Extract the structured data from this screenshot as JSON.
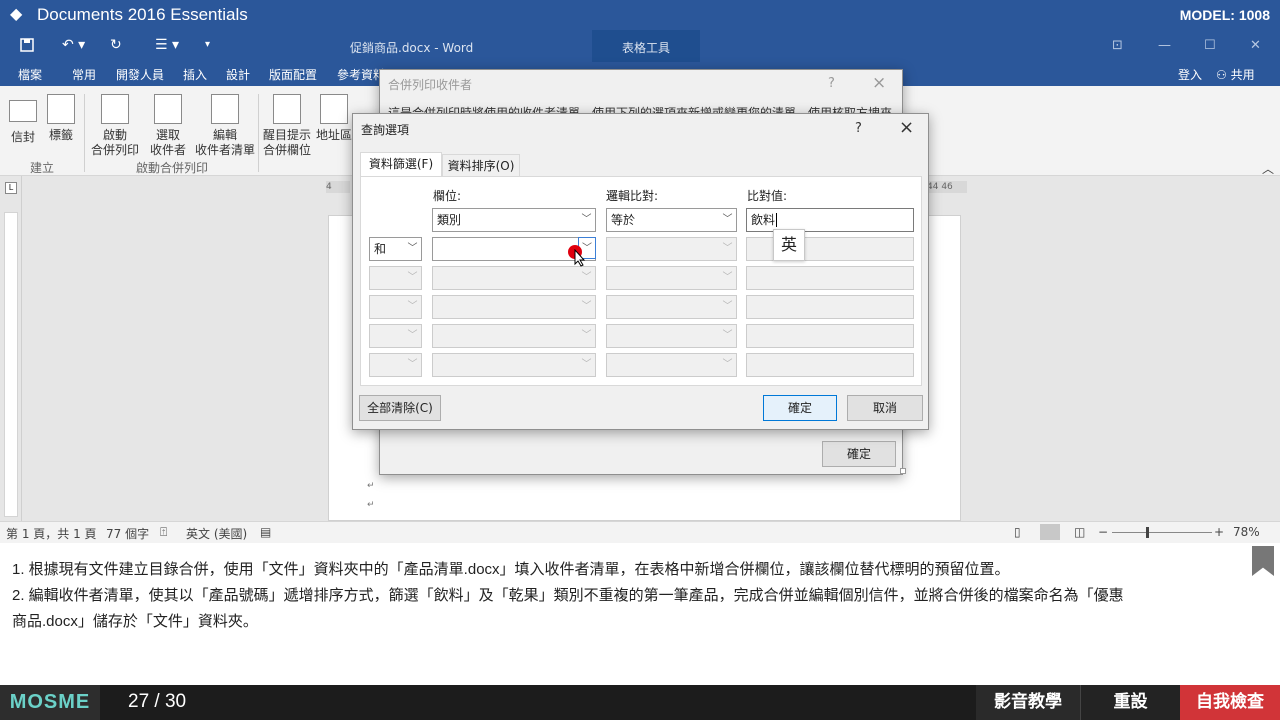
{
  "app": {
    "title": "Documents 2016 Essentials",
    "model": "MODEL: 1008"
  },
  "qat": {
    "doc_title": "促銷商品.docx - Word",
    "table_tools": "表格工具"
  },
  "tabs": [
    "檔案",
    "常用",
    "開發人員",
    "插入",
    "設計",
    "版面配置",
    "參考資料"
  ],
  "account": {
    "signin": "登入",
    "share": "共用"
  },
  "ribbon": {
    "envelope": "信封",
    "labels": "標籤",
    "group_create": "建立",
    "start_l1": "啟動",
    "start_l2": "合併列印",
    "select_l1": "選取",
    "select_l2": "收件者",
    "edit_l1": "編輯",
    "edit_l2": "收件者清單",
    "group_start": "啟動合併列印",
    "highlight_l1": "醒目提示",
    "highlight_l2": "合併欄位",
    "address_l1": "地址區"
  },
  "ruler": {
    "left_tick": "4",
    "right_ticks": "44  46"
  },
  "mail_merge_dialog": {
    "title": "合併列印收件者",
    "help": "?",
    "close": "×",
    "desc": "這是合併列印時將使用的收件者清單。使用下列的選項來新增或變更您的清單。使用核取方塊來",
    "ok": "確定"
  },
  "query_dialog": {
    "title": "查詢選項",
    "help": "?",
    "close": "×",
    "tab_filter": "資料篩選(F)",
    "tab_sort": "資料排序(O)",
    "col_field": "欄位:",
    "col_compare": "邏輯比對:",
    "col_value": "比對值:",
    "rows": [
      {
        "op": "",
        "field": "類別",
        "compare": "等於",
        "value": "飲料"
      },
      {
        "op": "和",
        "field": "",
        "compare": "",
        "value": ""
      },
      {
        "op": "",
        "field": "",
        "compare": "",
        "value": ""
      },
      {
        "op": "",
        "field": "",
        "compare": "",
        "value": ""
      },
      {
        "op": "",
        "field": "",
        "compare": "",
        "value": ""
      },
      {
        "op": "",
        "field": "",
        "compare": "",
        "value": ""
      }
    ],
    "ime": "英",
    "clear_all": "全部清除(C)",
    "ok": "確定",
    "cancel": "取消"
  },
  "status": {
    "page": "第 1 頁，共 1 頁",
    "words": "77 個字",
    "lang": "英文 (美國)",
    "zoom": "78%"
  },
  "instructions": {
    "line1": "1. 根據現有文件建立目錄合併，使用「文件」資料夾中的「產品清單.docx」填入收件者清單，在表格中新增合併欄位，讓該欄位替代標明的預留位置。",
    "line2": "2. 編輯收件者清單，使其以「產品號碼」遞增排序方式，篩選「飲料」及「乾果」類別不重複的第一筆產品，完成合併並編輯個別信件，並將合併後的檔案命名為「優惠",
    "line3": "商品.docx」儲存於「文件」資料夾。"
  },
  "bottom": {
    "brand": "MOSME",
    "progress": "27 / 30",
    "video": "影音教學",
    "reset": "重設",
    "selfcheck": "自我檢查"
  },
  "colors": {
    "word_blue": "#2b579a",
    "selfcheck_red": "#d13438",
    "cursor_red": "#e0000f"
  }
}
